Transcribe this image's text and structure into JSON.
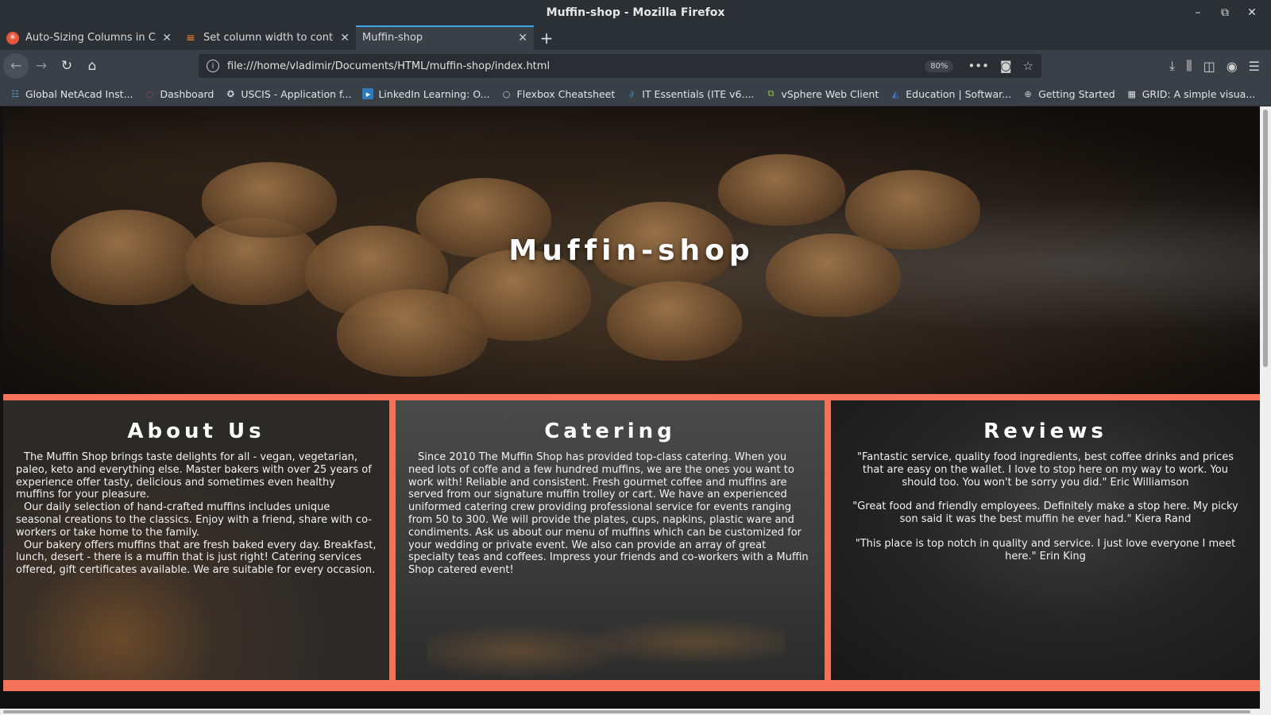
{
  "window": {
    "title": "Muffin-shop - Mozilla Firefox",
    "controls": [
      "–",
      "⧉",
      "✕"
    ]
  },
  "tabs": [
    {
      "label": "Auto-Sizing Columns in CSS G",
      "icon": "codepen-icon",
      "active": false
    },
    {
      "label": "Set column width to content l",
      "icon": "stackoverflow-icon",
      "active": false
    },
    {
      "label": "Muffin-shop",
      "icon": "",
      "active": true
    }
  ],
  "toolbar": {
    "url": "file:///home/vladimir/Documents/HTML/muffin-shop/index.html",
    "zoom": "80%"
  },
  "bookmarks": [
    {
      "label": "Global NetAcad Inst...",
      "icon": "netacad-icon",
      "color": "#5aa0d8"
    },
    {
      "label": "Dashboard",
      "icon": "dashboard-icon",
      "color": "#e04848"
    },
    {
      "label": "USCIS - Application f...",
      "icon": "uscis-icon",
      "color": "#cfd8e0"
    },
    {
      "label": "LinkedIn Learning: O...",
      "icon": "linkedin-icon",
      "color": "#2f7bbf"
    },
    {
      "label": "Flexbox Cheatsheet",
      "icon": "flexbox-icon",
      "color": "#cccccc"
    },
    {
      "label": "IT Essentials (ITE v6....",
      "icon": "ite-icon",
      "color": "#3a8ad6"
    },
    {
      "label": "vSphere Web Client",
      "icon": "vsphere-icon",
      "color": "#8fc43c"
    },
    {
      "label": "Education | Softwar...",
      "icon": "education-icon",
      "color": "#3b7ddd"
    },
    {
      "label": "Getting Started",
      "icon": "globe-icon",
      "color": "#cccccc"
    },
    {
      "label": "GRID: A simple visua...",
      "icon": "grid-icon",
      "color": "#dddddd"
    }
  ],
  "page": {
    "hero_title": "Muffin-shop",
    "about": {
      "heading": "About Us",
      "paragraphs": [
        "The Muffin Shop brings taste delights for all - vegan, vegetarian, paleo, keto and everything else. Master bakers with over 25 years of experience offer tasty, delicious and sometimes even healthy muffins for your pleasure.",
        "Our daily selection of hand-crafted muffins includes unique seasonal creations to the classics. Enjoy with a friend, share with co-workers or take home to the family.",
        "Our bakery offers muffins that are fresh baked every day. Breakfast, lunch, desert - there is a muffin that is just right! Catering services offered, gift certificates available. We are suitable for every occasion."
      ]
    },
    "catering": {
      "heading": "Catering",
      "text": "Since 2010 The Muffin Shop has provided top-class catering. When you need lots of coffe and a few hundred muffins, we are the ones you want to work with! Reliable and consistent. Fresh gourmet coffee and muffins are served from our signature muffin trolley or cart. We have an experienced uniformed catering crew providing professional service for events ranging from 50 to 300. We will provide the plates, cups, napkins, plastic ware and condiments. Ask us about our menu of muffins which can be customized for your wedding or private event. We also can provide an array of great specialty teas and coffees. Impress your friends and co-workers with a Muffin Shop catered event!"
    },
    "reviews": {
      "heading": "Reviews",
      "items": [
        "\"Fantastic service, quality food ingredients, best coffee drinks and prices that are easy on the wallet. I love to stop here on my way to work. You should too. You won't be sorry you did.\" Eric Williamson",
        "\"Great food and friendly employees. Definitely make a stop here. My picky son said it was the best muffin he ever had.\" Kiera Rand",
        "\"This place is top notch in quality and service. I just love everyone I meet here.\" Erin King"
      ]
    }
  },
  "colors": {
    "accent_border": "#f4725a",
    "active_tab_indicator": "#3ea6e8"
  }
}
